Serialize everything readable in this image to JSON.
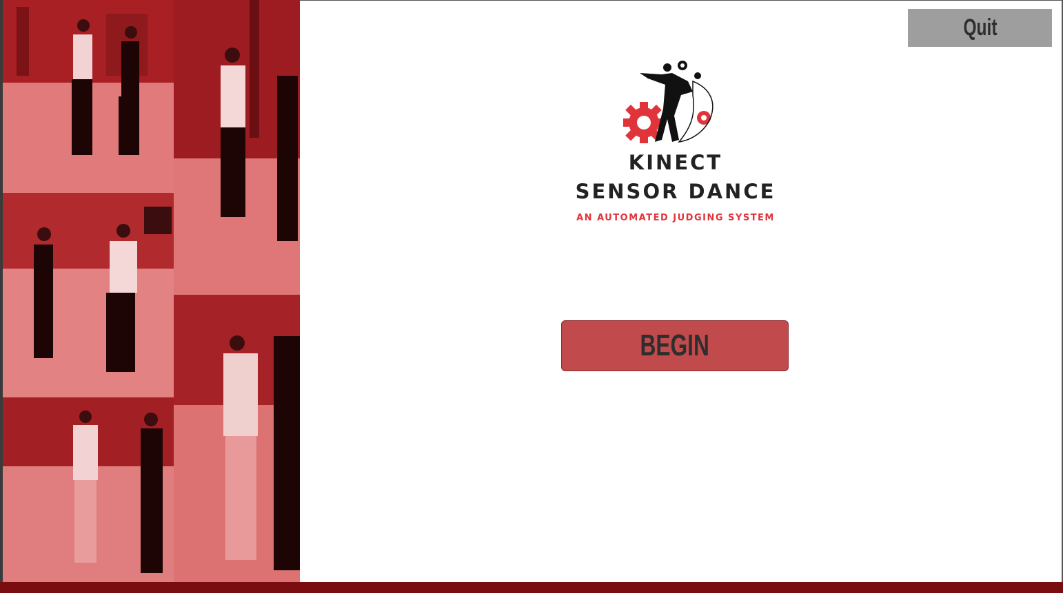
{
  "buttons": {
    "quit_label": "Quit",
    "begin_label": "BEGIN"
  },
  "logo": {
    "title_line1": "KINECT",
    "title_line2": "SENSOR DANCE",
    "tagline": "AN AUTOMATED JUDGING SYSTEM"
  },
  "colors": {
    "accent_red": "#c04a4c",
    "collage_tint": "#c1272d",
    "quit_button": "#9e9e9e",
    "bottom_bar": "#7a0d10"
  },
  "collage": {
    "photos": [
      "dancers-photo-1",
      "dancers-photo-2",
      "dancers-photo-3",
      "dancers-photo-4",
      "dancers-photo-5"
    ]
  }
}
